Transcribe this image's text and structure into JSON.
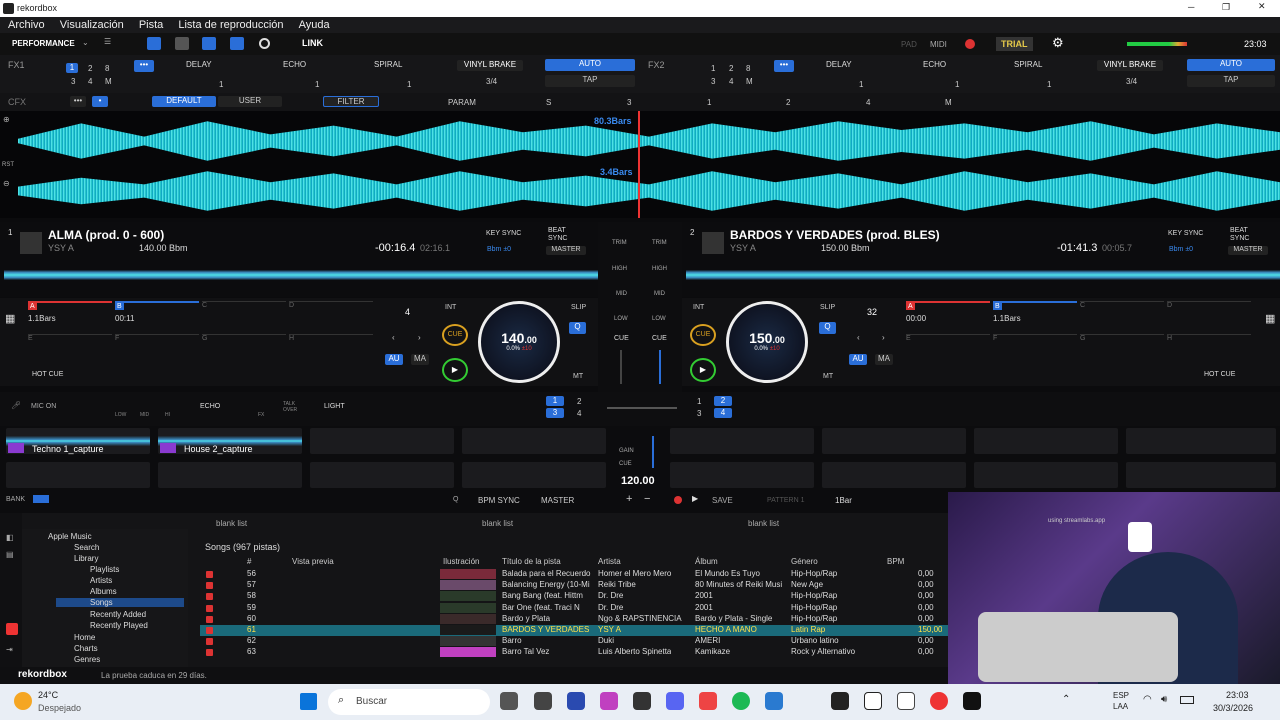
{
  "window": {
    "title": "rekordbox"
  },
  "menu": [
    "Archivo",
    "Visualización",
    "Pista",
    "Lista de reproducción",
    "Ayuda"
  ],
  "topbar": {
    "mode": "PERFORMANCE",
    "link": "LINK",
    "pad": "PAD",
    "midi": "MIDI",
    "trial": "TRIAL",
    "clock": "23:03"
  },
  "fx1": {
    "label": "FX1",
    "beats": [
      "1",
      "2",
      "8",
      "3",
      "4",
      "M"
    ],
    "effects": [
      "DELAY",
      "ECHO",
      "SPIRAL"
    ],
    "brake": "VINYL BRAKE",
    "brake_val": "3/4",
    "auto": "AUTO",
    "tap": "TAP",
    "vals": [
      "1",
      "1",
      "1"
    ]
  },
  "fx2": {
    "label": "FX2",
    "beats": [
      "1",
      "2",
      "8",
      "3",
      "4",
      "M"
    ],
    "effects": [
      "DELAY",
      "ECHO",
      "SPIRAL"
    ],
    "brake": "VINYL BRAKE",
    "brake_val": "3/4",
    "auto": "AUTO",
    "tap": "TAP",
    "vals": [
      "1",
      "1",
      "1"
    ]
  },
  "cfx": {
    "label": "CFX",
    "default": "DEFAULT",
    "user": "USER",
    "filter": "FILTER",
    "param": "PARAM",
    "s": "S",
    "nums": [
      "3",
      "1",
      "2",
      "4"
    ],
    "m": "M"
  },
  "waves": {
    "bars_top": "80.3Bars",
    "bars_bottom": "3.4Bars",
    "rst": "RST"
  },
  "deck1": {
    "num": "1",
    "title": "ALMA (prod. 0 - 600)",
    "artist": "YSY A",
    "bpm_label": "140.00 Bbm",
    "elapsed": "-00:16.4",
    "total": "02:16.1",
    "keysync": "KEY SYNC",
    "beatsync": "BEAT SYNC",
    "bbm": "Bbm ±0",
    "master": "MASTER",
    "cues": [
      {
        "l": "A",
        "v": "1.1Bars"
      },
      {
        "l": "B",
        "v": "00:11"
      },
      {
        "l": "C",
        "v": ""
      },
      {
        "l": "D",
        "v": ""
      },
      {
        "l": "E",
        "v": ""
      },
      {
        "l": "F",
        "v": ""
      },
      {
        "l": "G",
        "v": ""
      },
      {
        "l": "H",
        "v": ""
      }
    ],
    "hotcue": "HOT CUE",
    "loop": "4",
    "int": "INT",
    "cue": "CUE",
    "slip": "SLIP",
    "q": "Q",
    "au": "AU",
    "ma": "MA",
    "mt": "MT",
    "bpm": "140",
    "bpm_dec": ".00",
    "pitch": "0.0%",
    "pitch_range": "±10"
  },
  "deck2": {
    "num": "2",
    "title": "BARDOS Y VERDADES (prod. BLES)",
    "artist": "YSY A",
    "bpm_label": "150.00 Bbm",
    "elapsed": "-01:41.3",
    "total": "00:05.7",
    "keysync": "KEY SYNC",
    "beatsync": "BEAT SYNC",
    "bbm": "Bbm ±0",
    "master": "MASTER",
    "cues": [
      {
        "l": "A",
        "v": "00:00"
      },
      {
        "l": "B",
        "v": "1.1Bars"
      },
      {
        "l": "C",
        "v": ""
      },
      {
        "l": "D",
        "v": ""
      },
      {
        "l": "E",
        "v": ""
      },
      {
        "l": "F",
        "v": ""
      },
      {
        "l": "G",
        "v": ""
      },
      {
        "l": "H",
        "v": ""
      }
    ],
    "hotcue": "HOT CUE",
    "loop": "32",
    "int": "INT",
    "cue": "CUE",
    "slip": "SLIP",
    "q": "Q",
    "au": "AU",
    "ma": "MA",
    "mt": "MT",
    "bpm": "150",
    "bpm_dec": ".00",
    "pitch": "0.0%",
    "pitch_range": "±10"
  },
  "mixer": {
    "trim": "TRIM",
    "high": "HIGH",
    "mid": "MID",
    "low": "LOW",
    "cue": "CUE"
  },
  "mic": {
    "mic_on": "MIC ON",
    "low": "LOW",
    "mid": "MID",
    "hi": "HI",
    "echo": "ECHO",
    "fx": "FX",
    "talkover": "TALK OVER",
    "light": "LIGHT",
    "gain": "GAIN",
    "cue": "CUE"
  },
  "sampler": {
    "slot1": "Techno 1_capture",
    "slot2": "House 2_capture",
    "bpm": "120.00",
    "bank": "BANK",
    "q": "Q",
    "bpmsync": "BPM SYNC",
    "master": "MASTER",
    "save": "SAVE",
    "pattern": "PATTERN 1",
    "bar": "1Bar"
  },
  "browser": {
    "tree": [
      "Apple Music",
      "Search",
      "Library",
      "Playlists",
      "Artists",
      "Albums",
      "Songs",
      "Recently Added",
      "Recently Played",
      "Home",
      "Charts",
      "Genres"
    ],
    "blank": [
      "blank list",
      "blank list",
      "blank list"
    ],
    "songs_count": "Songs (967 pistas)",
    "cols": [
      "#",
      "Vista previa",
      "Ilustración",
      "Título de la pista",
      "Artista",
      "Álbum",
      "Género",
      "BPM"
    ],
    "rows": [
      [
        "56",
        "Balada para el Recuerdo",
        "Homer el Mero Mero",
        "El Mundo Es Tuyo",
        "Hip-Hop/Rap",
        "0,00"
      ],
      [
        "57",
        "Balancing Energy (10-Mi",
        "Reiki Tribe",
        "80 Minutes of Reiki Musi",
        "New Age",
        "0,00"
      ],
      [
        "58",
        "Bang Bang (feat. Hittm",
        "Dr. Dre",
        "2001",
        "Hip-Hop/Rap",
        "0,00"
      ],
      [
        "59",
        "Bar One (feat. Traci N",
        "Dr. Dre",
        "2001",
        "Hip-Hop/Rap",
        "0,00"
      ],
      [
        "60",
        "Bardo y Plata",
        "Ngo & RAPSTINENCIA",
        "Bardo y Plata - Single",
        "Hip-Hop/Rap",
        "0,00"
      ],
      [
        "61",
        "BARDOS Y VERDADES",
        "YSY A",
        "HECHO A MANO",
        "Latin Rap",
        "150,00"
      ],
      [
        "62",
        "Barro",
        "Duki",
        "AMERI",
        "Urbano latino",
        "0,00"
      ],
      [
        "63",
        "Barro Tal Vez",
        "Luis Alberto Spinetta",
        "Kamikaze",
        "Rock y Alternativo",
        "0,00"
      ]
    ],
    "status": "La prueba caduca en 29 días.",
    "logo": "rekordbox"
  },
  "taskbar": {
    "temp": "24°C",
    "weather": "Despejado",
    "search": "Buscar",
    "lang1": "ESP",
    "lang2": "LAA",
    "time": "23:03",
    "date": "30/3/2026"
  },
  "webcam": {
    "watermark": "using streamlabs.app"
  }
}
